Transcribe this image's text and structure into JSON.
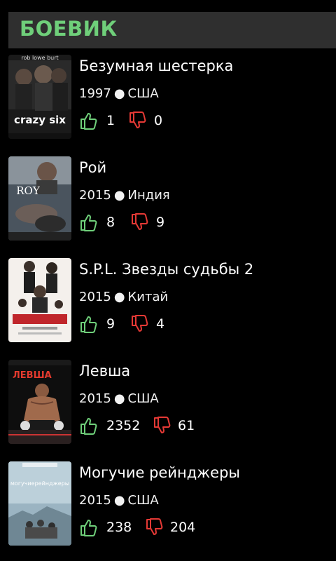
{
  "header": {
    "title": "БОЕВИК"
  },
  "movies": [
    {
      "title": "Безумная шестерка",
      "year": "1997",
      "country": "США",
      "likes": "1",
      "dislikes": "0",
      "poster_text": "crazy six",
      "poster_top": "rob lowe  burt"
    },
    {
      "title": "Рой",
      "year": "2015",
      "country": "Индия",
      "likes": "8",
      "dislikes": "9",
      "poster_text": "ROY"
    },
    {
      "title": "S.P.L. Звезды судьбы 2",
      "year": "2015",
      "country": "Китай",
      "likes": "9",
      "dislikes": "4"
    },
    {
      "title": "Левша",
      "year": "2015",
      "country": "США",
      "likes": "2352",
      "dislikes": "61",
      "poster_text": "ЛЕВША"
    },
    {
      "title": "Могучие рейнджеры",
      "year": "2015",
      "country": "США",
      "likes": "238",
      "dislikes": "204",
      "poster_text": "могучиерейнджеры"
    }
  ],
  "separator": "●",
  "colors": {
    "accent": "#6fcf7a",
    "like": "#6fcf7a",
    "dislike": "#e53935",
    "header_bg": "#2f2f2f"
  }
}
